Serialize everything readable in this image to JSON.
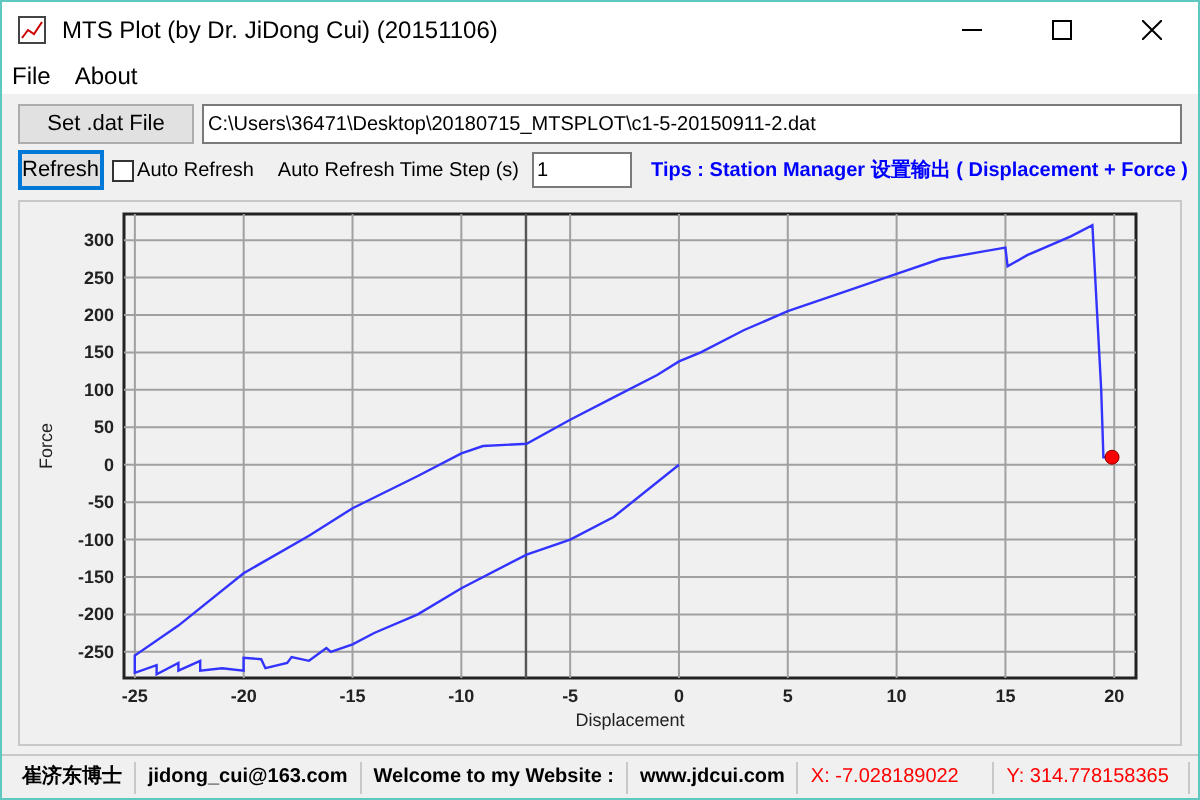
{
  "window": {
    "title": "MTS Plot (by Dr. JiDong Cui) (20151106)"
  },
  "menu": [
    "File",
    "About"
  ],
  "toolbar": {
    "set_file_button": "Set .dat File",
    "file_path": "C:\\Users\\36471\\Desktop\\20180715_MTSPLOT\\c1-5-20150911-2.dat",
    "refresh_button": {
      "label": "Refresh",
      "focused": true
    },
    "auto_refresh": {
      "label": "Auto Refresh",
      "checked": false
    },
    "time_step_label": "Auto Refresh Time Step (s)",
    "time_step": "1",
    "tips": "Tips : Station Manager 设置输出 ( Displacement + Force )"
  },
  "chart": {
    "chart_data": {
      "type": "line",
      "xlabel": "Displacement",
      "ylabel": "Force",
      "xlim": [
        -25.5,
        21
      ],
      "ylim": [
        -285,
        335
      ],
      "xticks": [
        -25,
        -20,
        -15,
        -10,
        -5,
        0,
        5,
        10,
        15,
        20
      ],
      "yticks": [
        -250,
        -200,
        -150,
        -100,
        -50,
        0,
        50,
        100,
        150,
        200,
        250,
        300
      ],
      "grid": true,
      "series": [
        {
          "color": "#3333ff",
          "x": [
            0,
            -3,
            -5,
            -7,
            -10,
            -12,
            -14,
            -15,
            -16,
            -16.2,
            -17,
            -17.8,
            -18,
            -19,
            -19.2,
            -20,
            -20,
            -21,
            -22,
            -22,
            -23,
            -23,
            -24,
            -24,
            -25,
            -25,
            -23,
            -20,
            -17,
            -15,
            -12,
            -10,
            -9,
            -7,
            -5,
            -3,
            -1,
            0,
            1,
            3,
            5,
            8,
            10,
            12,
            14,
            15,
            15.1,
            16,
            18,
            19,
            19.4,
            19.5,
            19.9
          ],
          "values": [
            0,
            -70,
            -100,
            -120,
            -165,
            -200,
            -225,
            -240,
            -250,
            -245,
            -262,
            -257,
            -265,
            -272,
            -260,
            -258,
            -275,
            -272,
            -275,
            -262,
            -275,
            -265,
            -280,
            -268,
            -278,
            -255,
            -215,
            -145,
            -95,
            -58,
            -15,
            15,
            25,
            28,
            60,
            90,
            120,
            138,
            150,
            180,
            205,
            235,
            255,
            275,
            285,
            290,
            265,
            280,
            305,
            320,
            100,
            10,
            10
          ]
        }
      ],
      "ref_lines": [
        {
          "axis": "x",
          "value": -7.03
        }
      ]
    }
  },
  "status_bar": [
    {
      "text": "崔济东博士",
      "color": "#000000"
    },
    {
      "text": "jidong_cui@163.com",
      "color": "#000000"
    },
    {
      "text": "Welcome to my Website :",
      "color": "#000000"
    },
    {
      "text": "www.jdcui.com",
      "color": "#000000"
    },
    {
      "text": "X: -7.028189022",
      "color": "#ff0000"
    },
    {
      "text": "Y: 314.778158365",
      "color": "#ff0000"
    }
  ]
}
